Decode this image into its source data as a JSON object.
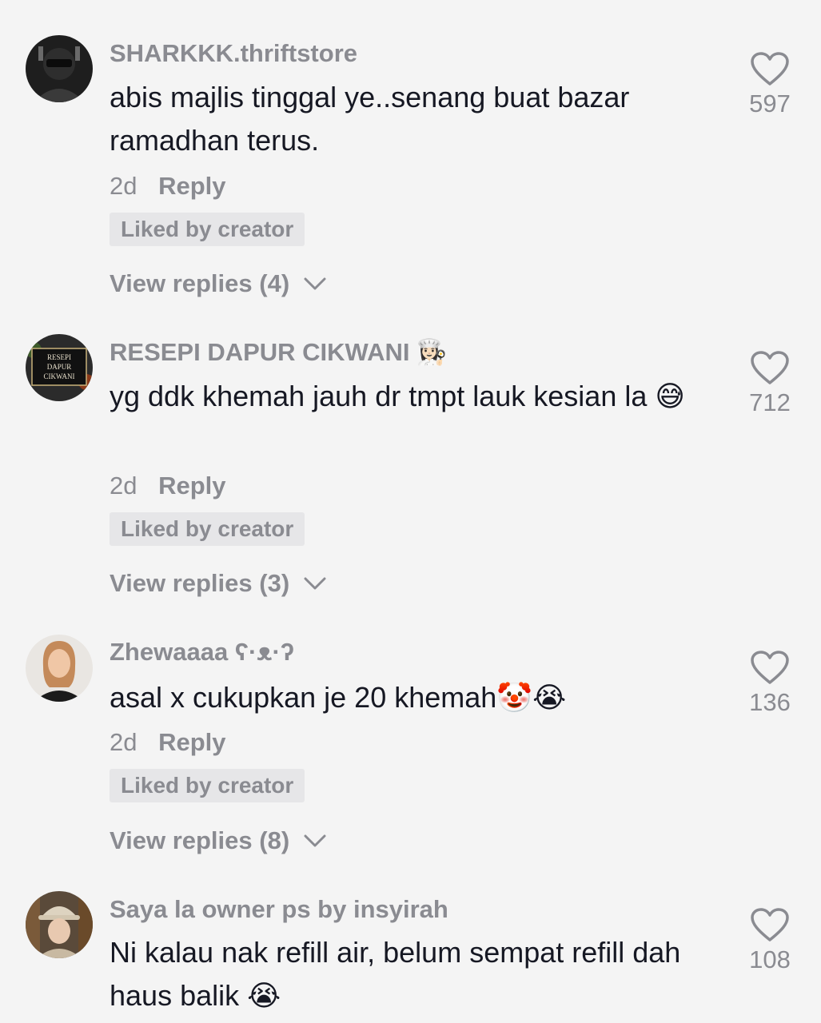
{
  "comments": [
    {
      "username": "SHARKKK.thriftstore",
      "username_emoji": "",
      "text": "abis majlis tinggal ye..senang buat bazar ramadhan terus.",
      "time": "2d",
      "reply_label": "Reply",
      "liked_badge": "Liked by creator",
      "view_replies": "View replies (4)",
      "likes": "597"
    },
    {
      "username": "RESEPI DAPUR CIKWANI",
      "username_emoji": "👩🏻‍🍳",
      "avatar_text": [
        "RESEPI",
        "DAPUR",
        "CIKWANI"
      ],
      "text": "yg ddk khemah jauh dr tmpt lauk kesian la 😅",
      "time": "2d",
      "reply_label": "Reply",
      "liked_badge": "Liked by creator",
      "view_replies": "View replies (3)",
      "likes": "712"
    },
    {
      "username": "Zhewaaaa ʕ·ᴥ·ʔ",
      "username_emoji": "",
      "text": "asal x cukupkan je 20 khemah🤡😭",
      "time": "2d",
      "reply_label": "Reply",
      "liked_badge": "Liked by creator",
      "view_replies": "View replies (8)",
      "likes": "136"
    },
    {
      "username": "Saya la owner ps by insyirah",
      "username_emoji": "",
      "text": "Ni kalau nak refill air, belum sempat refill dah haus balik 😭",
      "likes": "108"
    }
  ],
  "colors": {
    "background": "#f4f4f4",
    "secondary_text": "#8a8b91",
    "primary_text": "#161823",
    "badge_bg": "#e6e6e8"
  },
  "icons": [
    "heart-outline-icon",
    "chevron-down-icon"
  ]
}
